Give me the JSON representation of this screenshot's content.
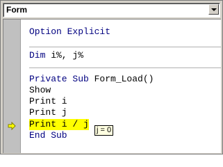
{
  "procedure_combo": {
    "value": "Form"
  },
  "code_lines": {
    "l1": {
      "kw": "Option Explicit",
      "rest": ""
    },
    "l2": {
      "kw": "Dim",
      "rest": " i%, j%"
    },
    "l3": {
      "kw": "Private Sub",
      "rest": " Form_Load()"
    },
    "l4": {
      "kw": "",
      "rest": "Show"
    },
    "l5": {
      "kw": "",
      "rest": "Print i"
    },
    "l6": {
      "kw": "",
      "rest": "Print j"
    },
    "l7": {
      "kw": "",
      "rest": "Print i / j"
    },
    "l8": {
      "kw": "End Sub",
      "rest": ""
    }
  },
  "data_tip": "j = 0",
  "current_line_icon": "execution-arrow-icon"
}
